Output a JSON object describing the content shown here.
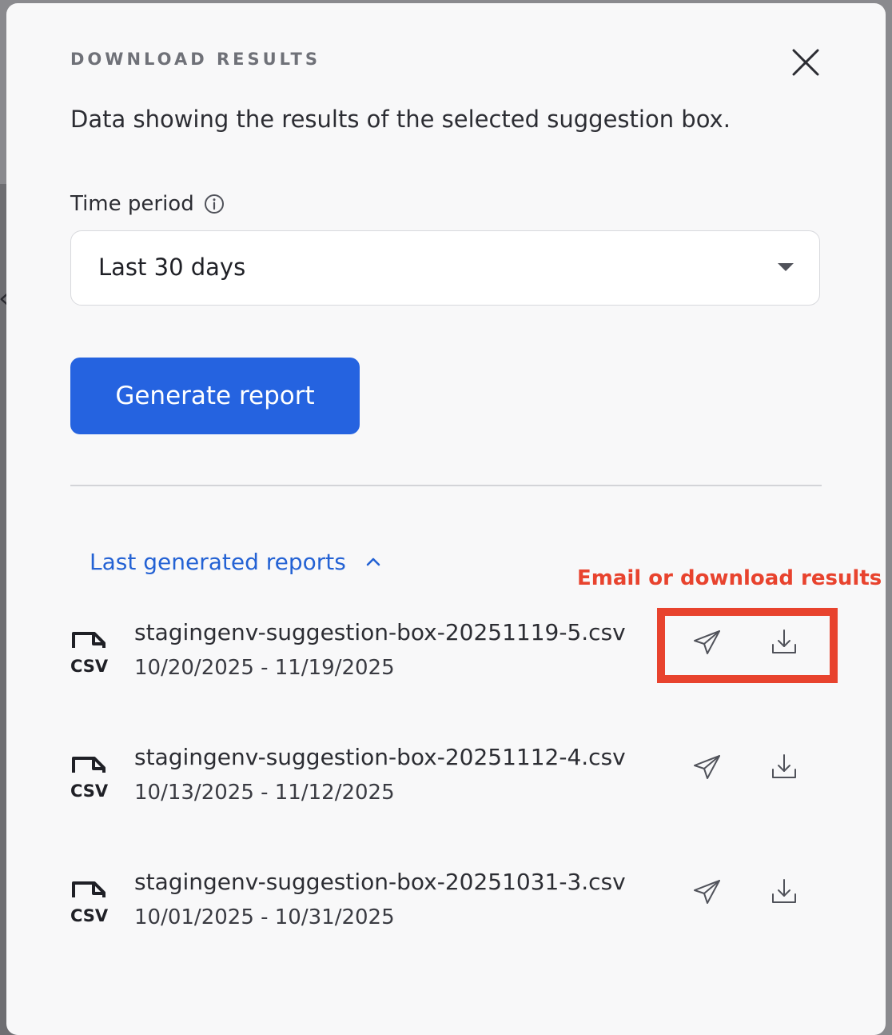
{
  "modal": {
    "title": "DOWNLOAD RESULTS",
    "subtitle": "Data showing the results of the selected suggestion box."
  },
  "time_period": {
    "label": "Time period",
    "selected": "Last 30 days"
  },
  "actions": {
    "generate_label": "Generate report"
  },
  "reports": {
    "toggle_label": "Last generated reports",
    "file_type": "CSV",
    "items": [
      {
        "name": "stagingenv-suggestion-box-20251119-5.csv",
        "range": "10/20/2025 - 11/19/2025"
      },
      {
        "name": "stagingenv-suggestion-box-20251112-4.csv",
        "range": "10/13/2025 - 11/12/2025"
      },
      {
        "name": "stagingenv-suggestion-box-20251031-3.csv",
        "range": "10/01/2025 - 10/31/2025"
      }
    ]
  },
  "annotation": {
    "text": "Email or download results",
    "color": "#e8432e"
  },
  "colors": {
    "primary": "#2563e0",
    "link": "#2462d4",
    "text": "#2c2d33",
    "muted": "#6f7178"
  },
  "icons": {
    "close": "close-icon",
    "info": "info-icon",
    "caret": "caret-down-icon",
    "collapse": "chevron-up-icon",
    "file": "csv-file-icon",
    "email": "paper-plane-icon",
    "download": "download-icon"
  }
}
